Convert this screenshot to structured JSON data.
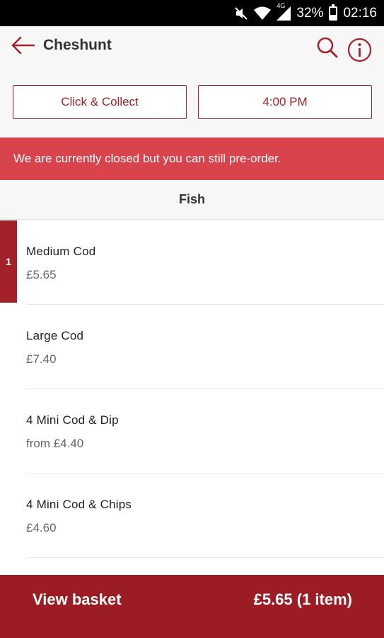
{
  "status_bar": {
    "battery": "32%",
    "time": "02:16",
    "network": "4G",
    "battery_level": 0.32,
    "icons": [
      "mute-icon",
      "wifi-icon",
      "signal-icon",
      "battery-icon"
    ]
  },
  "header": {
    "title": "Cheshunt",
    "icons": [
      "back-arrow-icon",
      "search-icon",
      "info-icon"
    ]
  },
  "selectors": {
    "order_type": "Click & Collect",
    "time": "4:00 PM"
  },
  "banner": {
    "message": "We are currently closed but you can still pre-order."
  },
  "category": {
    "title": "Fish"
  },
  "menu_items": [
    {
      "name": "Medium Cod",
      "price": "£5.65",
      "quantity": "1"
    },
    {
      "name": "Large Cod",
      "price": "£7.40"
    },
    {
      "name": "4 Mini Cod & Dip",
      "price": "from £4.40"
    },
    {
      "name": "4 Mini Cod & Chips",
      "price": "£4.60"
    }
  ],
  "basket": {
    "label": "View basket",
    "total": "£5.65 (1 item)"
  },
  "colors": {
    "accent": "#a3222a",
    "banner": "#d9434c",
    "basket_bar": "#9c1c23"
  }
}
